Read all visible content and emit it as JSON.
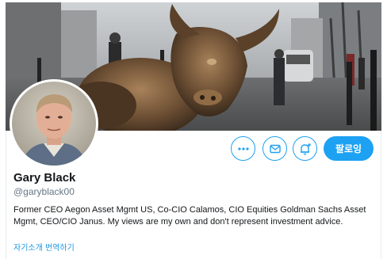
{
  "banner": {
    "description_icon": "bull-photo-icon"
  },
  "avatar": {
    "icon": "avatar-photo-icon"
  },
  "actions": {
    "more_icon": "ellipsis-icon",
    "dm_icon": "envelope-icon",
    "notify_icon": "bell-plus-icon",
    "follow_label": "팔로잉"
  },
  "profile": {
    "display_name": "Gary Black",
    "handle": "@garyblack00",
    "bio": "Former CEO Aegon Asset Mgmt US, Co-CIO Calamos, CIO Equities Goldman Sachs Asset Mgmt, CEO/CIO Janus. My views are my own and don't represent investment advice.",
    "translate_label": "자기소개 번역하기"
  },
  "colors": {
    "accent": "#1da1f2",
    "link": "#1b95e0",
    "secondary_text": "#657786"
  }
}
